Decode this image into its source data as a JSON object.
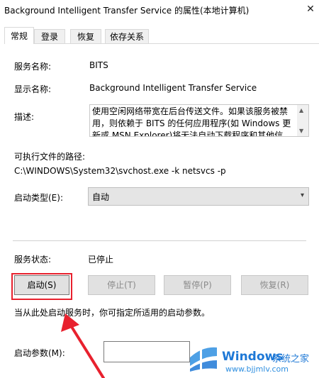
{
  "window": {
    "title": "Background Intelligent Transfer Service 的属性(本地计算机)",
    "close_glyph": "✕"
  },
  "tabs": [
    {
      "label": "常规",
      "active": true
    },
    {
      "label": "登录",
      "active": false
    },
    {
      "label": "恢复",
      "active": false
    },
    {
      "label": "依存关系",
      "active": false
    }
  ],
  "general": {
    "service_name_label": "服务名称:",
    "service_name_value": "BITS",
    "display_name_label": "显示名称:",
    "display_name_value": "Background Intelligent Transfer Service",
    "description_label": "描述:",
    "description_value": "使用空闲网络带宽在后台传送文件。如果该服务被禁用，则依赖于 BITS 的任何应用程序(如 Windows 更新或 MSN Explorer)将无法自动下载程序和其他信息。",
    "exe_path_label": "可执行文件的路径:",
    "exe_path_value": "C:\\WINDOWS\\System32\\svchost.exe -k netsvcs -p",
    "startup_type_label": "启动类型(E):",
    "startup_type_value": "自动",
    "service_status_label": "服务状态:",
    "service_status_value": "已停止"
  },
  "buttons": {
    "start": "启动(S)",
    "stop": "停止(T)",
    "pause": "暂停(P)",
    "resume": "恢复(R)"
  },
  "hint_text": "当从此处启动服务时，你可指定所适用的启动参数。",
  "start_params_label": "启动参数(M):",
  "start_params_value": "",
  "watermark": {
    "brand": "Windows",
    "brand_cn": "系统之家",
    "url": "www.bjjmlv.com"
  },
  "colors": {
    "highlight_border": "#e8212e",
    "watermark_blue": "#1e78d6"
  }
}
